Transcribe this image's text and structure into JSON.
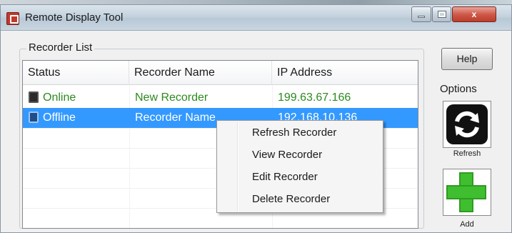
{
  "window": {
    "title": "Remote Display Tool",
    "close_label": "x"
  },
  "recorder_list": {
    "group_label": "Recorder List",
    "columns": [
      "Status",
      "Recorder Name",
      "IP Address"
    ],
    "rows": [
      {
        "status": "Online",
        "name": "New Recorder",
        "ip": "199.63.67.166",
        "selected": false
      },
      {
        "status": "Offline",
        "name": "Recorder Name",
        "ip": "192.168.10.136",
        "selected": true
      }
    ]
  },
  "context_menu": {
    "items": [
      "Refresh Recorder",
      "View Recorder",
      "Edit Recorder",
      "Delete Recorder"
    ]
  },
  "side_panel": {
    "help_label": "Help",
    "options_label": "Options",
    "refresh_caption": "Refresh",
    "add_caption": "Add"
  },
  "colors": {
    "online_text": "#2c8a1e",
    "selection": "#3399ff",
    "add_icon": "#3fbf2f"
  },
  "icons": {
    "app": "app-icon",
    "online": "recorder-online-icon",
    "offline": "recorder-offline-icon",
    "refresh": "refresh-icon",
    "add": "plus-icon"
  }
}
